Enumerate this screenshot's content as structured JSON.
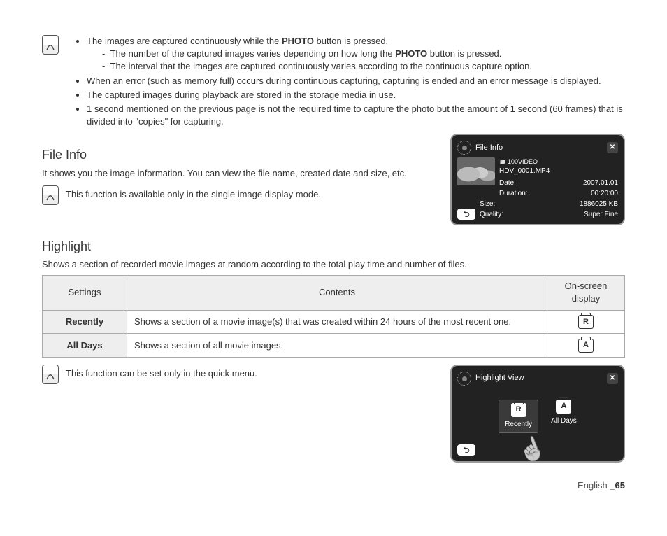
{
  "notes": {
    "b1_pre": "The images are captured continuously while the ",
    "b1_bold": "PHOTO",
    "b1_post": " button is pressed.",
    "b1a_pre": "The number of the captured images varies depending on how long the ",
    "b1a_bold": "PHOTO",
    "b1a_post": " button is pressed.",
    "b1b": "The interval that the images are captured continuously varies according to the continuous capture option.",
    "b2": "When an error (such as memory full) occurs during continuous capturing, capturing is ended and an error message is displayed.",
    "b3": "The captured images during playback are stored in the storage media in use.",
    "b4": "1 second mentioned on the previous page is not the required time to capture the photo but the amount of 1 second (60 frames) that is divided into \"copies\" for capturing."
  },
  "fileInfo": {
    "heading": "File Info",
    "desc": "It shows you the image information. You can view the file name, created date and size, etc.",
    "note": "This function is available only in the single image display mode.",
    "panel": {
      "title": "File Info",
      "folder": "100VIDEO",
      "filename": "HDV_0001.MP4",
      "rows": [
        {
          "k": "Date:",
          "v": "2007.01.01"
        },
        {
          "k": "Duration:",
          "v": "00:20:00"
        },
        {
          "k": "Size:",
          "v": "1886025 KB"
        },
        {
          "k": "Quality:",
          "v": "Super Fine"
        }
      ]
    }
  },
  "highlight": {
    "heading": "Highlight",
    "desc": "Shows a section of recorded movie images at random according to the total play time and number of files.",
    "headers": {
      "settings": "Settings",
      "contents": "Contents",
      "osd": "On-screen display"
    },
    "rows": [
      {
        "setting": "Recently",
        "content": "Shows a section of a movie image(s) that was created within 24 hours of the most recent one.",
        "badge": "R"
      },
      {
        "setting": "All Days",
        "content": "Shows a section of all movie images.",
        "badge": "A"
      }
    ],
    "note": "This function can be set only in the quick menu.",
    "panel": {
      "title": "Highlight View",
      "opt1": "Recently",
      "opt2": "All Days"
    }
  },
  "footer": {
    "lang": "English ",
    "page": "_65"
  }
}
